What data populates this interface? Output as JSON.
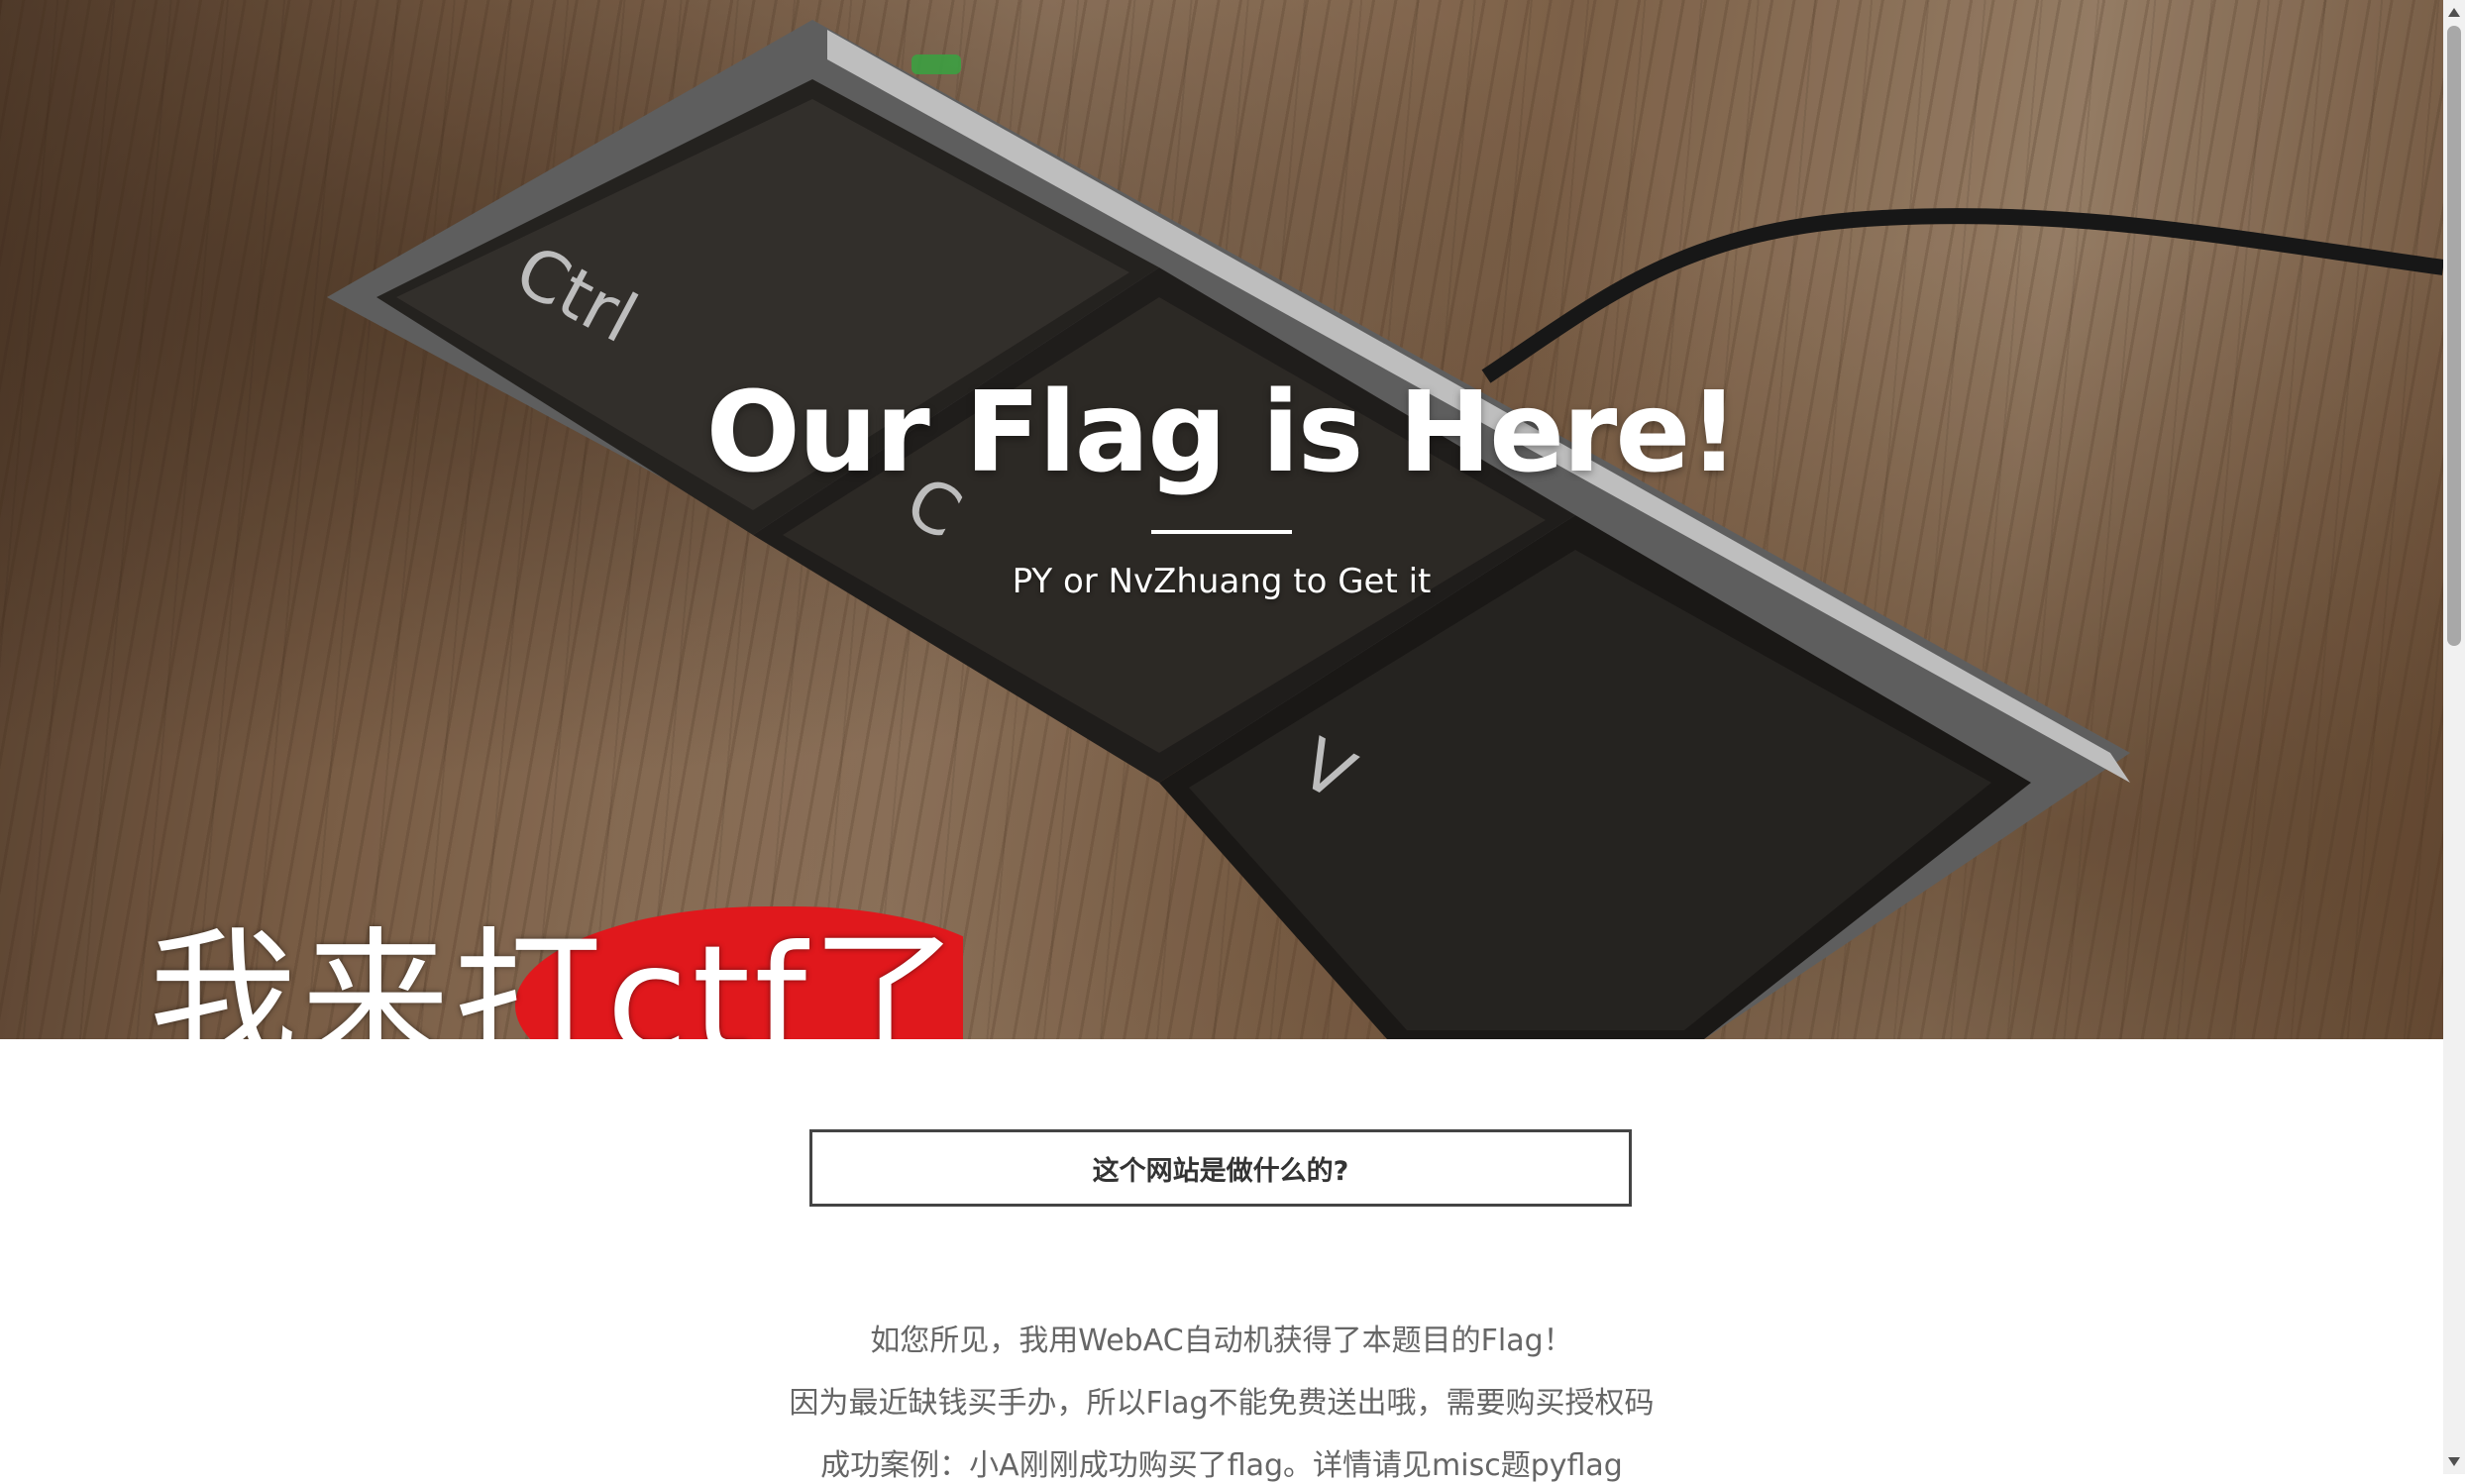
{
  "hero": {
    "title": "Our Flag is Here!",
    "subtitle": "PY or NvZhuang to Get it",
    "image": {
      "keys": [
        "Ctrl",
        "C",
        "V"
      ],
      "caption_parts": [
        "我来",
        "打ctf",
        "了"
      ]
    }
  },
  "main": {
    "faq_button_label": "这个网站是做什么的?",
    "lines": [
      "如您所见，我用WebAC自动机获得了本题目的Flag！",
      "因为最近缺钱买手办，所以Flag不能免费送出哦，需要购买授权码",
      "成功案例：小A刚刚成功购买了flag。详情请见misc题pyflag"
    ]
  },
  "colors": {
    "hero_text": "#ffffff",
    "button_border": "#444444",
    "body_text": "#666666"
  }
}
